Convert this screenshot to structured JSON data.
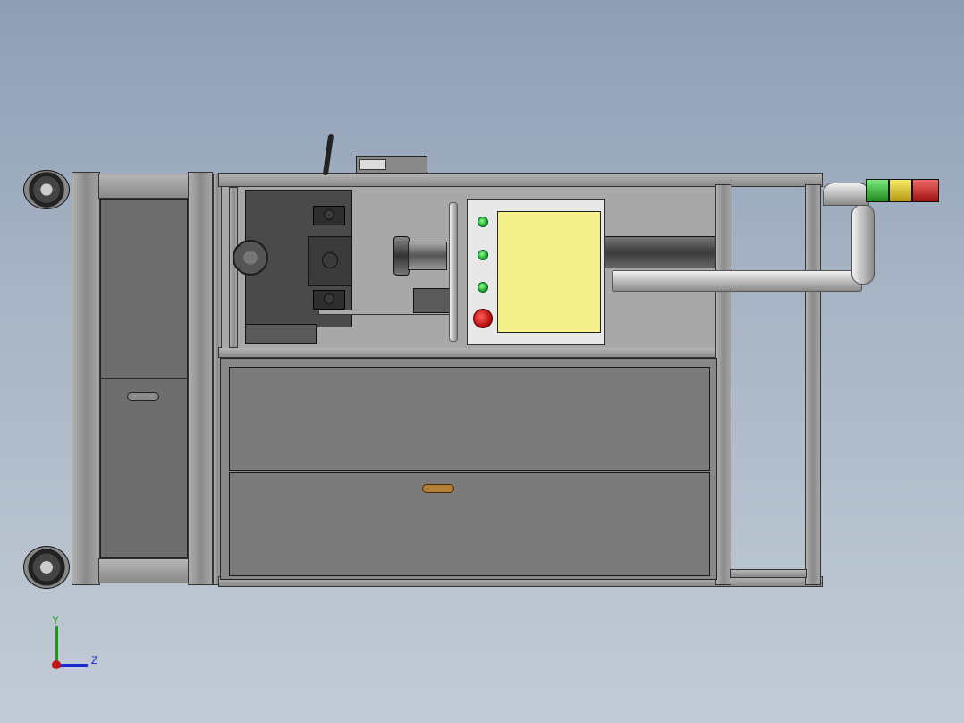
{
  "axis_triad": {
    "y_label": "Y",
    "z_label": "Z"
  },
  "colors": {
    "background_top": "#8e9fb5",
    "background_bottom": "#c3ccd6",
    "frame": "#9a9a9a",
    "panel_screen": "#f3f08a",
    "stack_light_green": "#3ab53a",
    "stack_light_yellow": "#e8d020",
    "stack_light_red": "#d21c1c",
    "drawer_handle": "#b0803a",
    "emergency_stop": "#d21c1c",
    "indicator_led": "#1fb51f"
  },
  "components": {
    "left_cabinet": "left-cabinet",
    "drawers": [
      "upper-drawer",
      "lower-drawer"
    ],
    "control_panel": {
      "indicators": 3,
      "emergency_stop": 1
    },
    "stack_light": [
      "green",
      "yellow",
      "red"
    ],
    "casters": 2
  }
}
